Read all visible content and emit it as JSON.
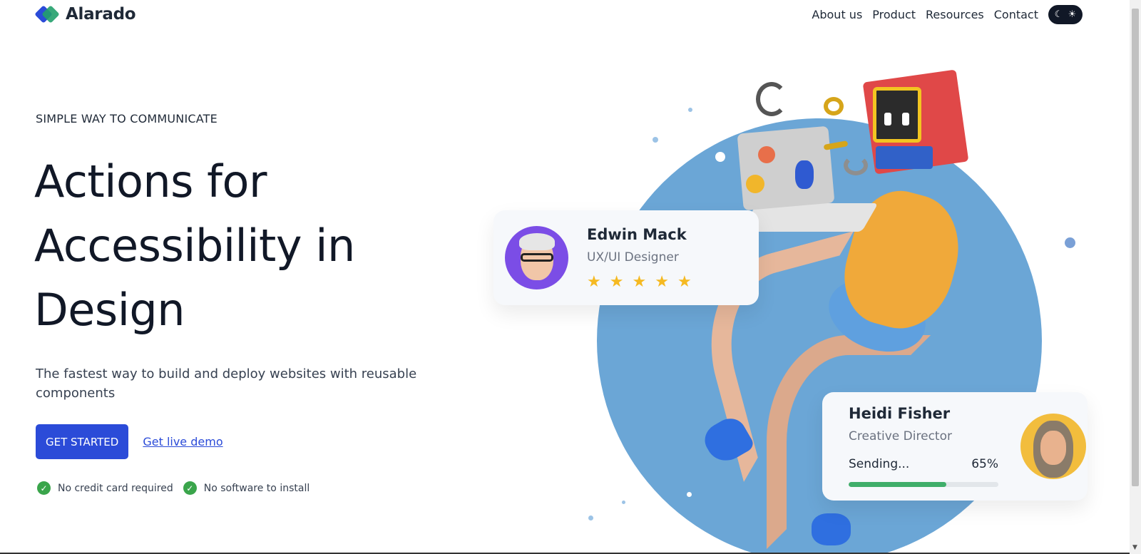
{
  "header": {
    "brand": "Alarado",
    "nav": [
      "About us",
      "Product",
      "Resources",
      "Contact"
    ]
  },
  "hero": {
    "eyebrow": "SIMPLE WAY TO COMMUNICATE",
    "headline_lines": [
      "Actions for",
      "Accessibility in",
      "Design"
    ],
    "subtext": "The fastest way to build and deploy websites with reusable components",
    "cta_primary": "GET STARTED",
    "cta_secondary": "Get live demo",
    "checks": [
      "No credit card required",
      "No software to install"
    ]
  },
  "cards": {
    "edwin": {
      "name": "Edwin Mack",
      "role": "UX/UI Designer",
      "rating": 5
    },
    "heidi": {
      "name": "Heidi Fisher",
      "role": "Creative Director",
      "status": "Sending...",
      "progress_label": "65%",
      "progress": 0.65
    }
  },
  "colors": {
    "primary": "#2b4bd8",
    "success": "#3aa54b",
    "circle": "#6ba6d6",
    "star": "#f5b921",
    "progress": "#3fae6a"
  },
  "icons": {
    "logo": "diamond-logo-icon",
    "theme": [
      "moon-icon",
      "sun-icon"
    ],
    "check": "check-circle-icon",
    "star": "star-icon"
  }
}
